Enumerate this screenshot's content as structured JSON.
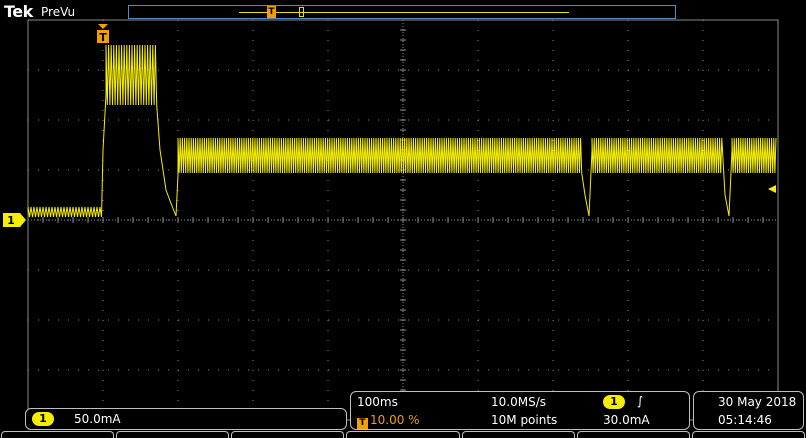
{
  "header": {
    "brand": "Tek",
    "mode": "PreVu"
  },
  "channel1": {
    "number": "1",
    "scale": "50.0mA",
    "color": "#f5ee00"
  },
  "horizontal": {
    "time_per_div": "100ms",
    "trigger_position": "10.00 %",
    "trigger_marker": "T",
    "sample_rate": "10.0MS/s",
    "record_length": "10M points"
  },
  "trigger": {
    "source": "1",
    "slope_symbol": "∫",
    "level": "30.0mA"
  },
  "datetime": {
    "date": "30 May 2018",
    "time": "05:14:46"
  },
  "colors": {
    "trace": "#f5ee00",
    "trigger": "#f0a000",
    "grid": "#8a8a8a"
  },
  "menu": {
    "labels": [
      "",
      "",
      "",
      "",
      "",
      "",
      ""
    ]
  }
}
